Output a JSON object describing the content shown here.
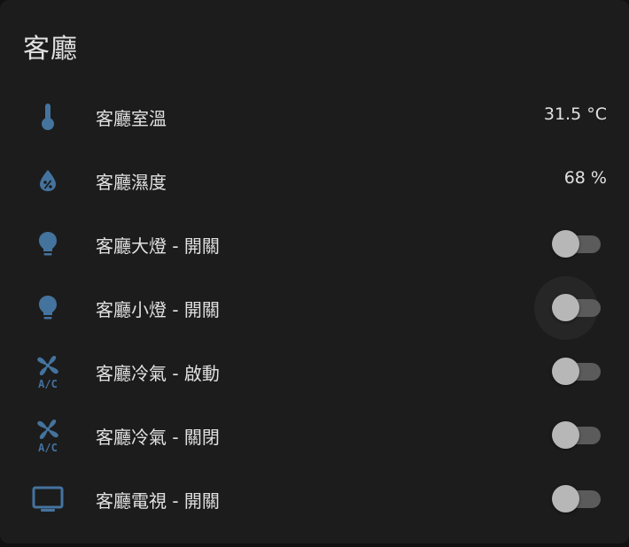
{
  "card": {
    "title": "客廳"
  },
  "colors": {
    "icon": "#44739e",
    "text": "#e1e1e1",
    "card_bg": "#1c1c1c",
    "toggle_track": "#5b5b5b",
    "toggle_thumb": "#b7b7b7"
  },
  "rows": [
    {
      "icon": "thermometer-icon",
      "label": "客廳室溫",
      "value": "31.5 °C"
    },
    {
      "icon": "water-percent-icon",
      "label": "客廳濕度",
      "value": "68 %"
    },
    {
      "icon": "lightbulb-icon",
      "label": "客廳大燈 - 開關",
      "state": "off"
    },
    {
      "icon": "lightbulb-icon",
      "label": "客廳小燈 - 開關",
      "state": "off"
    },
    {
      "icon": "air-conditioner-icon",
      "label": "客廳冷氣 - 啟動",
      "state": "off"
    },
    {
      "icon": "air-conditioner-icon",
      "label": "客廳冷氣 - 關閉",
      "state": "off"
    },
    {
      "icon": "television-icon",
      "label": "客廳電視 - 開關",
      "state": "off"
    }
  ],
  "ac_icon_text": "A/C"
}
